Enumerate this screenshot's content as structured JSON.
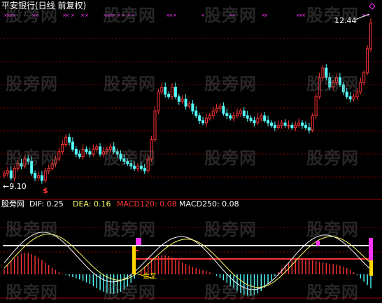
{
  "title": "平安银行(日线 前复权)",
  "price_high_label": "12.44",
  "price_low_label": "←9.10",
  "signal_glyph": "$",
  "watermark": "股旁网",
  "indicator": {
    "name": "股旁网",
    "dif_label": "DIF: 0.25",
    "dea_label": "DEA: 0.16",
    "macd120_label": "MACD120: 0.08",
    "macd250_label": "MACD250: 0.08",
    "tag_label": "金叉"
  },
  "colors": {
    "up": "#ff3333",
    "down": "#54ffff",
    "grid": "#8b0000",
    "dif": "#ffffff",
    "dea": "#ffff66",
    "magenta": "#ff33ff",
    "gold": "#ffd700",
    "macd120": "#ff3333"
  },
  "chart_data": [
    {
      "type": "candlestick",
      "title": "平安银行(日线 前复权)",
      "ylim": [
        9.0,
        12.6
      ],
      "annotations": [
        "12.44",
        "←9.10"
      ],
      "close": [
        9.3,
        9.35,
        9.2,
        9.4,
        9.5,
        9.45,
        9.6,
        9.55,
        9.3,
        9.2,
        9.25,
        9.15,
        9.35,
        9.4,
        9.5,
        9.6,
        9.75,
        9.9,
        10.05,
        9.95,
        9.8,
        9.7,
        9.65,
        9.8,
        9.75,
        9.7,
        9.8,
        9.85,
        9.7,
        9.75,
        9.8,
        9.85,
        9.75,
        9.7,
        9.6,
        9.55,
        9.5,
        9.45,
        9.4,
        9.45,
        9.4,
        9.35,
        9.6,
        10.0,
        10.6,
        11.0,
        11.1,
        10.95,
        10.9,
        11.1,
        10.9,
        10.8,
        10.85,
        10.7,
        10.75,
        10.6,
        10.5,
        10.4,
        10.35,
        10.45,
        10.5,
        10.6,
        10.65,
        10.7,
        10.55,
        10.5,
        10.45,
        10.5,
        10.55,
        10.6,
        10.5,
        10.45,
        10.4,
        10.35,
        10.45,
        10.5,
        10.4,
        10.35,
        10.3,
        10.25,
        10.3,
        10.35,
        10.3,
        10.3,
        10.25,
        10.3,
        10.35,
        10.3,
        10.25,
        10.2,
        10.5,
        10.9,
        11.3,
        11.5,
        11.3,
        11.1,
        11.2,
        11.3,
        11.15,
        11.0,
        10.9,
        10.85,
        10.9,
        11.0,
        11.2,
        11.4,
        11.9,
        12.44
      ]
    },
    {
      "type": "line",
      "title": "股旁网",
      "series": [
        {
          "name": "DIF",
          "latest": 0.25
        },
        {
          "name": "DEA",
          "latest": 0.16
        },
        {
          "name": "MACD120",
          "latest": 0.08
        },
        {
          "name": "MACD250",
          "latest": 0.08
        }
      ]
    }
  ]
}
